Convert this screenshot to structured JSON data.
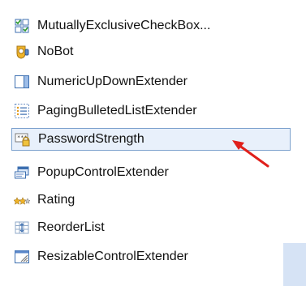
{
  "toolbox": {
    "items": [
      {
        "label": "MutuallyExclusiveCheckBox...",
        "icon": "checkbox-group-icon"
      },
      {
        "label": "NoBot",
        "icon": "bot-shield-icon"
      },
      {
        "label": "NumericUpDownExtender",
        "icon": "numeric-updown-icon"
      },
      {
        "label": "PagingBulletedListExtender",
        "icon": "bulleted-list-icon"
      },
      {
        "label": "PasswordStrength",
        "icon": "password-lock-icon"
      },
      {
        "label": "PopupControlExtender",
        "icon": "popup-control-icon"
      },
      {
        "label": "Rating",
        "icon": "rating-stars-icon"
      },
      {
        "label": "ReorderList",
        "icon": "reorder-list-icon"
      },
      {
        "label": "ResizableControlExtender",
        "icon": "resizable-control-icon"
      }
    ],
    "selected_label": "PasswordStrength"
  },
  "colors": {
    "selection_background": "#e8f0fb",
    "selection_border": "#7da2ce",
    "annotation_arrow": "#e0201b"
  }
}
